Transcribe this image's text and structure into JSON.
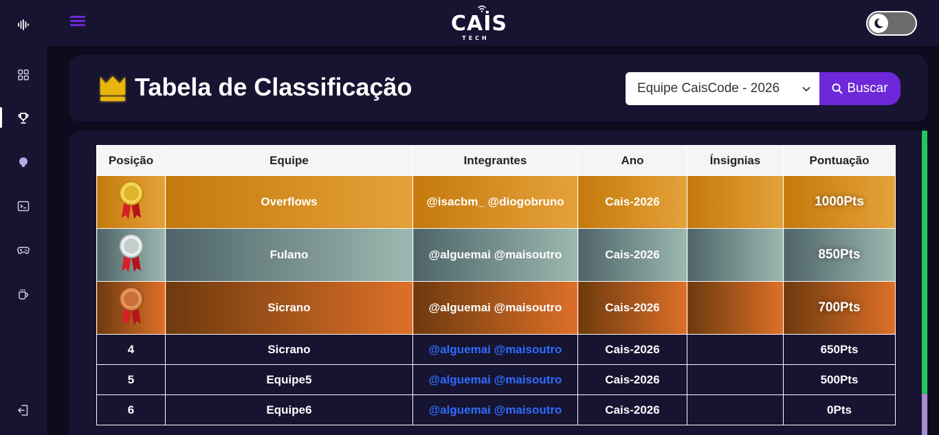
{
  "app": {
    "logo_main": "CAİS",
    "logo_sub": "TECH"
  },
  "sidebar": {
    "items": [
      {
        "icon": "waveform-icon"
      },
      {
        "icon": "grid-icon"
      },
      {
        "icon": "trophy-icon"
      },
      {
        "icon": "bulb-icon"
      },
      {
        "icon": "terminal-icon"
      },
      {
        "icon": "gamepad-icon"
      },
      {
        "icon": "coffee-icon"
      },
      {
        "icon": "logout-icon"
      }
    ]
  },
  "header": {
    "title": "Tabela de Classificação",
    "select_value": "Equipe CaisCode - 2026",
    "search_label": "Buscar"
  },
  "table": {
    "columns": [
      "Posição",
      "Equipe",
      "Integrantes",
      "Ano",
      "Ínsignias",
      "Pontuação"
    ],
    "rows": [
      {
        "position": "",
        "medal": "gold",
        "team": "Overflows",
        "members": "@isacbm_ @diogobruno",
        "year": "Cais-2026",
        "badges": "",
        "points": "1000Pts"
      },
      {
        "position": "",
        "medal": "silver",
        "team": "Fulano",
        "members": "@alguemai @maisoutro",
        "year": "Cais-2026",
        "badges": "",
        "points": "850Pts"
      },
      {
        "position": "",
        "medal": "bronze",
        "team": "Sicrano",
        "members": "@alguemai @maisoutro",
        "year": "Cais-2026",
        "badges": "",
        "points": "700Pts"
      },
      {
        "position": "4",
        "team": "Sicrano",
        "members": "@alguemai @maisoutro",
        "year": "Cais-2026",
        "badges": "",
        "points": "650Pts"
      },
      {
        "position": "5",
        "team": "Equipe5",
        "members": "@alguemai @maisoutro",
        "year": "Cais-2026",
        "badges": "",
        "points": "500Pts"
      },
      {
        "position": "6",
        "team": "Equipe6",
        "members": "@alguemai @maisoutro",
        "year": "Cais-2026",
        "badges": "",
        "points": "0Pts"
      }
    ]
  },
  "colors": {
    "accent": "#6d28d9",
    "link": "#2e6cff",
    "background": "#0d0b1e",
    "panel": "#161431",
    "scroll": "#22c55e"
  }
}
